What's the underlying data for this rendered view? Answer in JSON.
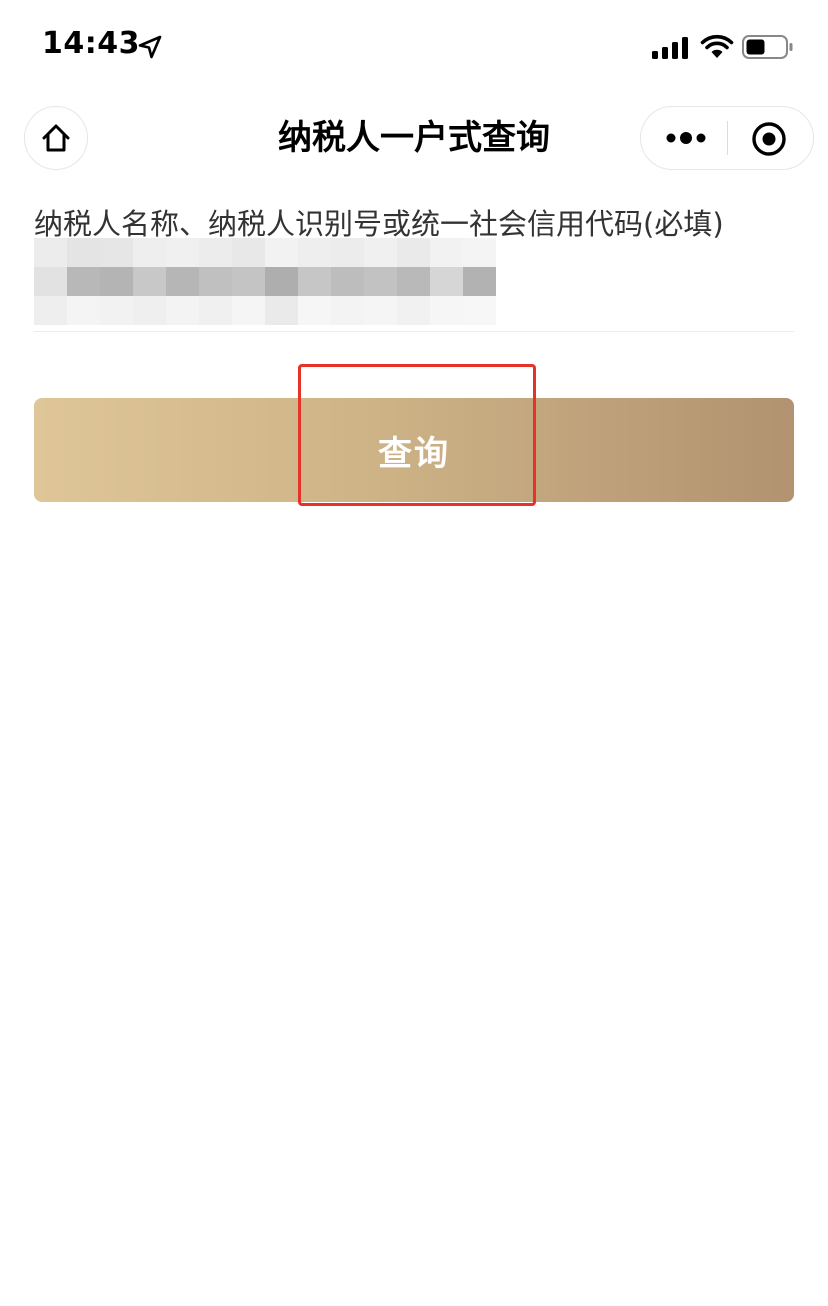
{
  "status_bar": {
    "time": "14:43",
    "icons": [
      "location-arrow-icon",
      "signal-icon",
      "wifi-icon",
      "battery-icon"
    ]
  },
  "nav": {
    "title": "纳税人一户式查询",
    "home_icon": "home-icon",
    "more_icon": "more-icon",
    "close_icon": "target-icon"
  },
  "form": {
    "label": "纳税人名称、纳税人识别号或统一社会信用代码(必填)",
    "input_value": "",
    "input_placeholder": ""
  },
  "query_button": {
    "label": "查询"
  },
  "colors": {
    "button_gradient_start": "#dfc698",
    "button_gradient_end": "#b29270",
    "highlight": "#e5332a"
  }
}
